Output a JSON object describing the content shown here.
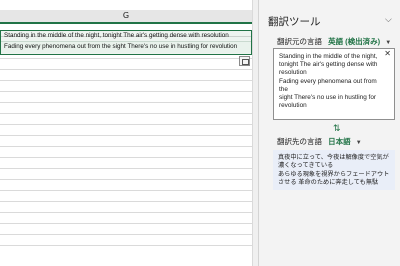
{
  "sheet": {
    "column_letter": "G",
    "cells": [
      "Standing in the middle of the night, tonight The air's getting dense with resolution",
      "Fading every phenomena out from the sight There's no use in hustling for revolution"
    ]
  },
  "pane": {
    "title": "翻訳ツール",
    "source_label": "翻訳元の言語",
    "source_language": "英語 (検出済み)",
    "target_label": "翻訳先の言語",
    "target_language": "日本語",
    "source_lines": [
      "Standing in the middle of the night,",
      "tonight The air's getting dense with",
      "resolution",
      "Fading every phenomena out from the",
      "sight There's no use in hustling for",
      "revolution"
    ],
    "target_lines": [
      "真夜中に立って、今夜は解像度で空気が",
      "濃くなってきている",
      "あらゆる現象を視界からフェードアウト",
      "させる 革命のために奔走しても無駄"
    ]
  },
  "colors": {
    "accent": "#217346",
    "target_bg": "#e9eef8"
  }
}
